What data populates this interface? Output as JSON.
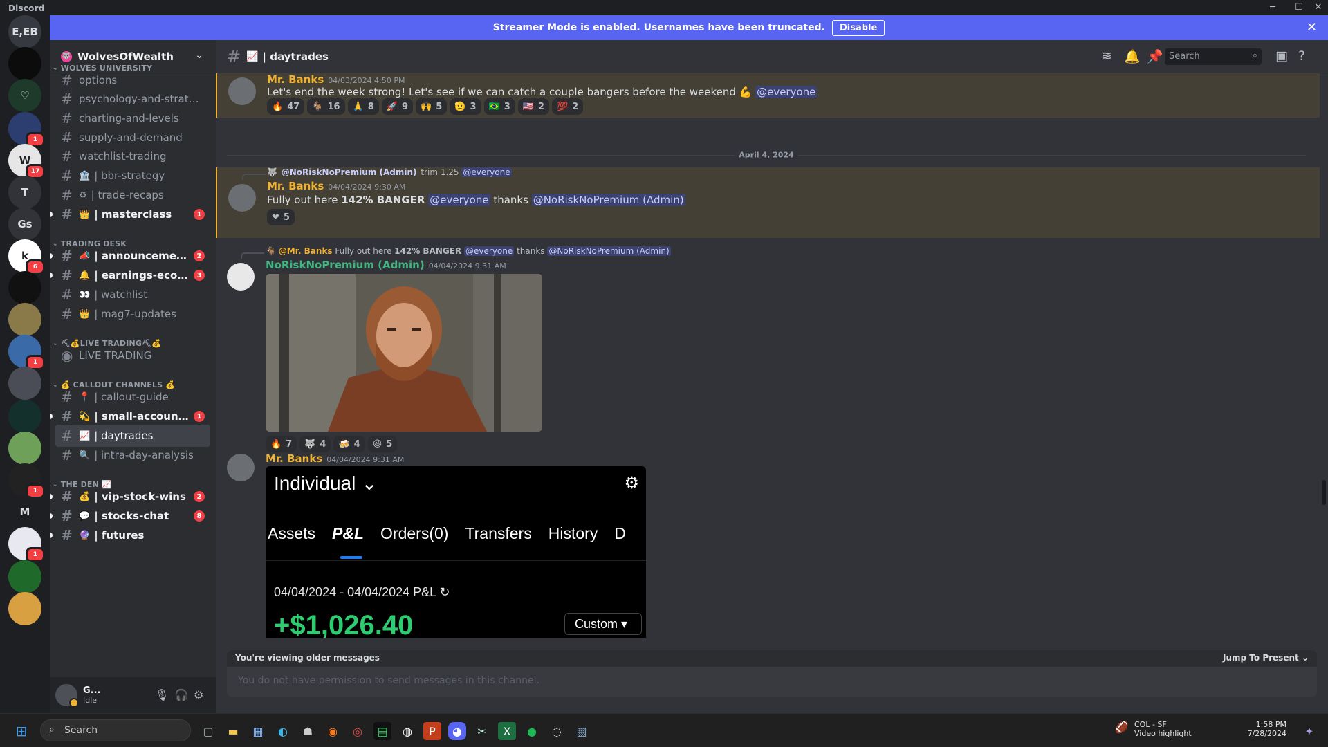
{
  "window": {
    "title": "Discord",
    "minimize": "─",
    "maximize": "☐",
    "close": "✕"
  },
  "guilds": [
    {
      "label": "E,EB",
      "bg": "#36393f"
    },
    {
      "label": "",
      "bg": "#0c0c0c"
    },
    {
      "label": "♡",
      "bg": "#1d3a2a"
    },
    {
      "label": "",
      "bg": "#2c3e70",
      "badge": "1"
    },
    {
      "label": "W",
      "bg": "#e6e6e6",
      "badge": "17"
    },
    {
      "label": "T",
      "bg": "#313338"
    },
    {
      "label": "Gs",
      "bg": "#313338"
    },
    {
      "label": "k",
      "bg": "#ffffff",
      "badge": "6"
    },
    {
      "label": "",
      "bg": "#111111"
    },
    {
      "label": "",
      "bg": "#8a7a4a"
    },
    {
      "label": "",
      "bg": "#3a6aa8",
      "badge": "1"
    },
    {
      "label": "",
      "bg": "#4a4d55"
    },
    {
      "label": "",
      "bg": "#14302c"
    },
    {
      "label": "",
      "bg": "#6ea05a"
    },
    {
      "label": "",
      "bg": "#222222",
      "badge": "1"
    },
    {
      "label": "M",
      "bg": "#1e1f22"
    },
    {
      "label": "",
      "bg": "#e8e8f0",
      "badge": "1"
    },
    {
      "label": "",
      "bg": "#1f6a2a"
    },
    {
      "label": "",
      "bg": "#d8a040"
    }
  ],
  "banner": {
    "text": "Streamer Mode is enabled. Usernames have been truncated.",
    "button": "Disable",
    "close": "✕"
  },
  "server": {
    "name": "WolvesOfWealth",
    "chevron": "⌄"
  },
  "categories": {
    "c1": "WOLVES UNIVERSITY",
    "c2": "TRADING DESK",
    "c3": "⛏💰LIVE TRADING⛏💰",
    "c4": "💰 CALLOUT CHANNELS 💰",
    "c5": "THE DEN 📈"
  },
  "channels": [
    {
      "name": "options",
      "emoji": ""
    },
    {
      "name": "psychology-and-strategi...",
      "emoji": ""
    },
    {
      "name": "charting-and-levels",
      "emoji": ""
    },
    {
      "name": "supply-and-demand",
      "emoji": ""
    },
    {
      "name": "watchlist-trading",
      "emoji": ""
    },
    {
      "name": "| bbr-strategy",
      "emoji": "🏦"
    },
    {
      "name": "| trade-recaps",
      "emoji": "♻"
    },
    {
      "name": "| masterclass",
      "emoji": "👑",
      "badge": "1"
    },
    {
      "name": "| announcements",
      "emoji": "📣",
      "badge": "2"
    },
    {
      "name": "| earnings-econo...",
      "emoji": "🔔",
      "badge": "3"
    },
    {
      "name": "| watchlist",
      "emoji": "👀"
    },
    {
      "name": "| mag7-updates",
      "emoji": "👑"
    },
    {
      "name": "LIVE TRADING",
      "emoji": ""
    },
    {
      "name": "| callout-guide",
      "emoji": "📍"
    },
    {
      "name": "| small-account-...",
      "emoji": "💫",
      "badge": "1"
    },
    {
      "name": "| daytrades",
      "emoji": "📈"
    },
    {
      "name": "| intra-day-analysis",
      "emoji": "🔍"
    },
    {
      "name": "| vip-stock-wins",
      "emoji": "💰",
      "badge": "2"
    },
    {
      "name": "| stocks-chat",
      "emoji": "💬",
      "badge": "8"
    },
    {
      "name": "| futures",
      "emoji": "🔮"
    }
  ],
  "user": {
    "name": "G...",
    "status": "Idle"
  },
  "header": {
    "channel": "| daytrades",
    "emoji": "📈",
    "search": "Search"
  },
  "messages": {
    "m1": {
      "author": "Mr. Banks",
      "time": "04/03/2024 4:50 PM",
      "text": "Let's end the week strong! Let's see if we can catch a couple bangers before the weekend 💪",
      "mention": "@everyone",
      "reactions": [
        {
          "e": "🔥",
          "n": "47"
        },
        {
          "e": "🐐",
          "n": "16"
        },
        {
          "e": "🙏",
          "n": "8"
        },
        {
          "e": "🚀",
          "n": "9"
        },
        {
          "e": "🙌",
          "n": "5"
        },
        {
          "e": "🫡",
          "n": "3"
        },
        {
          "e": "🇧🇷",
          "n": "3"
        },
        {
          "e": "🇺🇸",
          "n": "2"
        },
        {
          "e": "💯",
          "n": "2"
        }
      ]
    },
    "divider": "April 4, 2024",
    "m2": {
      "reply_author": "@NoRiskNoPremium (Admin)",
      "reply_text": "trim 1.25",
      "reply_mention": "@everyone",
      "author": "Mr. Banks",
      "time": "04/04/2024 9:30 AM",
      "pre": "Fully out here ",
      "bold": "142% BANGER",
      "mention": "@everyone",
      "mid": " thanks ",
      "mention2": "@NoRiskNoPremium (Admin)",
      "reactions": [
        {
          "e": "❤",
          "n": "5"
        }
      ]
    },
    "m3": {
      "reply_author": "@Mr. Banks",
      "reply_pre": "Fully out here ",
      "reply_bold": "142% BANGER",
      "reply_mention": "@everyone",
      "reply_mid": "thanks",
      "reply_mention2": "@NoRiskNoPremium (Admin)",
      "author": "NoRiskNoPremium (Admin)",
      "time": "04/04/2024 9:31 AM",
      "reactions": [
        {
          "e": "🔥",
          "n": "7"
        },
        {
          "e": "🐺",
          "n": "4"
        },
        {
          "e": "🍻",
          "n": "4"
        },
        {
          "e": "😆",
          "n": "5"
        }
      ]
    },
    "m4": {
      "author": "Mr. Banks",
      "time": "04/04/2024 9:31 AM"
    }
  },
  "pnl": {
    "account": "Individual",
    "tabs": [
      "Assets",
      "P&L",
      "Orders(0)",
      "Transfers",
      "History",
      "D"
    ],
    "range": "04/04/2024 - 04/04/2024 P&L",
    "value": "+$1,026.40",
    "dropdown": "Custom"
  },
  "older": {
    "text": "You're viewing older messages",
    "jump": "Jump To Present"
  },
  "composer": {
    "placeholder": "You do not have permission to send messages in this channel."
  },
  "taskbar": {
    "search": "Search",
    "weather_title": "COL - SF",
    "weather_sub": "Video highlight",
    "time": "1:58 PM",
    "date": "7/28/2024"
  },
  "colors": {
    "accent": "#5865f2",
    "highlight": "#f0b232",
    "author_gold": "#f0b232",
    "author_green": "#43b581"
  }
}
